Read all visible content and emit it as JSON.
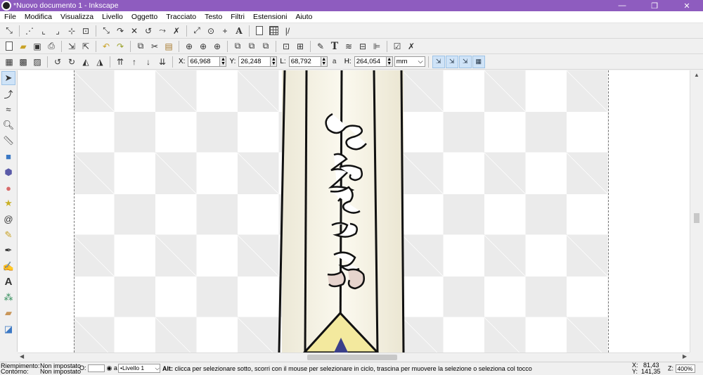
{
  "window": {
    "title": "*Nuovo documento 1 - Inkscape",
    "minimize": "—",
    "maximize": "❐",
    "close": "✕"
  },
  "menu": [
    "File",
    "Modifica",
    "Visualizza",
    "Livello",
    "Oggetto",
    "Tracciato",
    "Testo",
    "Filtri",
    "Estensioni",
    "Aiuto"
  ],
  "snap_toolbar": [
    "snap-enable-icon",
    "snap-bbox-icon",
    "snap-bbox-edge-icon",
    "snap-bbox-corner-icon",
    "snap-bbox-midpoint-icon",
    "snap-bbox-center-icon",
    "snap-nodes-icon",
    "snap-path-icon",
    "snap-intersection-icon",
    "snap-cusp-icon",
    "snap-smooth-icon",
    "snap-midpoint-icon",
    "snap-center-icon",
    "snap-rotation-icon",
    "snap-text-baseline-icon",
    "snap-page-icon",
    "snap-grid-icon",
    "snap-guide-icon"
  ],
  "command_toolbar": [
    "new-icon",
    "open-icon",
    "save-icon",
    "print-icon",
    "import-icon",
    "export-icon",
    "undo-icon",
    "redo-icon",
    "copy-icon",
    "cut-icon",
    "paste-icon",
    "zoom-selection-icon",
    "zoom-drawing-icon",
    "zoom-page-icon",
    "duplicate-icon",
    "clone-icon",
    "unlink-clone-icon",
    "group-icon",
    "ungroup-icon",
    "fill-stroke-icon",
    "text-font-icon",
    "layers-icon",
    "xml-editor-icon",
    "align-icon",
    "document-props-icon",
    "preferences-icon"
  ],
  "select_toolbar": {
    "icons": [
      "select-all-icon",
      "select-all-layers-icon",
      "deselect-icon",
      "rotate-ccw-icon",
      "rotate-cw-icon",
      "flip-h-icon",
      "flip-v-icon",
      "raise-top-icon",
      "raise-icon",
      "lower-icon",
      "lower-bottom-icon"
    ],
    "x_label": "X:",
    "x_value": "66,968",
    "y_label": "Y:",
    "y_value": "26,248",
    "w_label": "L:",
    "w_value": "68,792",
    "h_label": "H:",
    "h_value": "264,054",
    "unit": "mm",
    "affect": [
      "scale-stroke-icon",
      "scale-corners-icon",
      "transform-gradients-icon",
      "transform-patterns-icon"
    ]
  },
  "tools": [
    "selector-icon",
    "node-icon",
    "tweak-icon",
    "zoom-icon",
    "measure-icon",
    "rect-icon",
    "3dbox-icon",
    "ellipse-icon",
    "star-icon",
    "spiral-icon",
    "pencil-icon",
    "pen-icon",
    "calligraphy-icon",
    "text-icon",
    "spray-icon",
    "eraser-icon",
    "paint-bucket-icon"
  ],
  "status": {
    "fill_label": "Riempimento:",
    "fill_value": "Non impostato",
    "stroke_label": "Contorno:",
    "stroke_value": "Non impostato",
    "opacity_label": "O:",
    "layer": "•Livello 1",
    "message_bold": "Alt:",
    "message": " clicca per selezionare sotto, scorri con il mouse per selezionare in ciclo, trascina per muovere la selezione o seleziona col tocco",
    "x_label": "X:",
    "x_value": "81,43",
    "y_label": "Y:",
    "y_value": "141,35",
    "zoom_label": "Z:",
    "zoom_value": "400%"
  }
}
